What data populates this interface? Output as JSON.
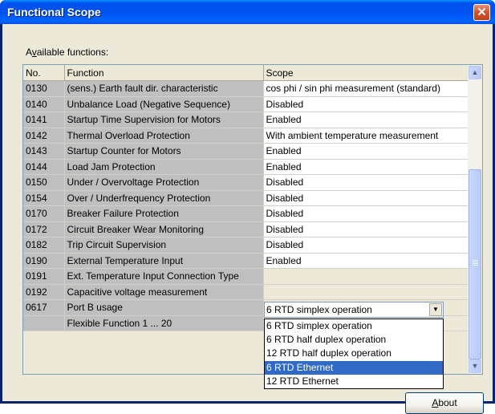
{
  "window": {
    "title": "Functional Scope",
    "close_glyph": "✕"
  },
  "available_label": "Available functions:",
  "table": {
    "columns": [
      "No.",
      "Function",
      "Scope"
    ],
    "rows": [
      {
        "no": "0130",
        "function": "(sens.) Earth fault dir. characteristic",
        "scope": "cos phi / sin phi measurement (standard)"
      },
      {
        "no": "0140",
        "function": "Unbalance Load (Negative Sequence)",
        "scope": "Disabled"
      },
      {
        "no": "0141",
        "function": "Startup Time Supervision for Motors",
        "scope": "Enabled"
      },
      {
        "no": "0142",
        "function": "Thermal Overload Protection",
        "scope": "With ambient temperature measurement"
      },
      {
        "no": "0143",
        "function": "Startup Counter for Motors",
        "scope": "Enabled"
      },
      {
        "no": "0144",
        "function": "Load Jam Protection",
        "scope": "Enabled"
      },
      {
        "no": "0150",
        "function": "Under / Overvoltage Protection",
        "scope": "Disabled"
      },
      {
        "no": "0154",
        "function": "Over / Underfrequency Protection",
        "scope": "Disabled"
      },
      {
        "no": "0170",
        "function": "Breaker Failure Protection",
        "scope": "Disabled"
      },
      {
        "no": "0172",
        "function": "Circuit Breaker Wear Monitoring",
        "scope": "Disabled"
      },
      {
        "no": "0182",
        "function": "Trip Circuit Supervision",
        "scope": "Disabled"
      },
      {
        "no": "0190",
        "function": "External Temperature Input",
        "scope": "Enabled"
      },
      {
        "no": "0191",
        "function": "Ext. Temperature Input Connection Type",
        "scope": ""
      },
      {
        "no": "0192",
        "function": "Capacitive voltage measurement",
        "scope": ""
      },
      {
        "no": "0617",
        "function": "Port B usage",
        "scope": ""
      },
      {
        "no": "",
        "function": "Flexible Function 1 ... 20",
        "scope": ""
      }
    ]
  },
  "combo": {
    "value": "6 RTD simplex operation",
    "arrow_glyph": "▼",
    "options": [
      {
        "label": "6 RTD simplex operation",
        "selected": false
      },
      {
        "label": "6 RTD half duplex operation",
        "selected": false
      },
      {
        "label": "12 RTD half duplex operation",
        "selected": false
      },
      {
        "label": "6 RTD Ethernet",
        "selected": true
      },
      {
        "label": "12 RTD Ethernet",
        "selected": false
      }
    ]
  },
  "scrollbar": {
    "up_glyph": "▲",
    "down_glyph": "▼"
  },
  "buttons": {
    "about": "About"
  },
  "colors": {
    "title_bar": "#0053ee",
    "selection": "#316ac5",
    "grey_cell": "#bfbfbf"
  }
}
